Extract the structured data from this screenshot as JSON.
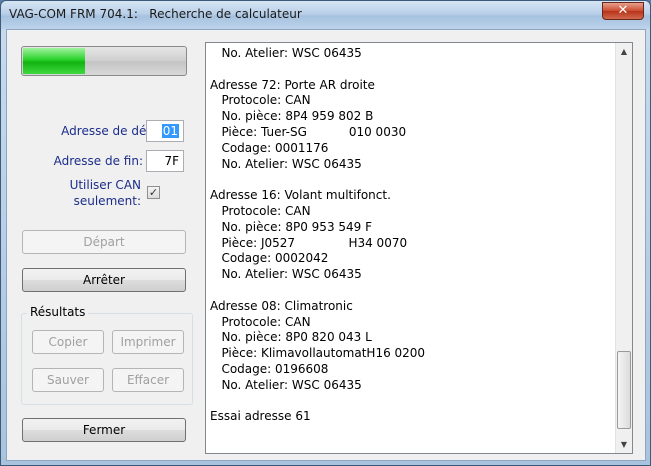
{
  "window": {
    "title": "VAG-COM FRM 704.1:   Recherche de calculateur",
    "close_glyph": "✕"
  },
  "progress": {
    "fraction": 0.38,
    "color": "#22c422"
  },
  "form": {
    "start_label": "Adresse de départ:",
    "start_value": "01",
    "end_label": "Adresse de fin:",
    "end_value": "7F",
    "can_label_line1": "Utiliser CAN",
    "can_label_line2": "seulement:",
    "can_checked": true,
    "check_glyph": "✓"
  },
  "buttons": {
    "start": "Départ",
    "stop": "Arrêter",
    "close": "Fermer"
  },
  "results_group": {
    "label": "Résultats",
    "copy": "Copier",
    "print": "Imprimer",
    "save": "Sauver",
    "clear": "Effacer"
  },
  "results_lines": [
    "   No. Atelier: WSC 06435",
    "",
    "Adresse 72: Porte AR droite",
    "   Protocole: CAN",
    "   No. pièce: 8P4 959 802 B",
    "   Pièce: Tuer-SG           010 0030",
    "   Codage: 0001176",
    "   No. Atelier: WSC 06435",
    "",
    "Adresse 16: Volant multifonct.",
    "   Protocole: CAN",
    "   No. pièce: 8P0 953 549 F",
    "   Pièce: J0527              H34 0070",
    "   Codage: 0002042",
    "   No. Atelier: WSC 06435",
    "",
    "Adresse 08: Climatronic",
    "   Protocole: CAN",
    "   No. pièce: 8P0 820 043 L",
    "   Pièce: KlimavollautomatH16 0200",
    "   Codage: 0196608",
    "   No. Atelier: WSC 06435",
    "",
    "Essai adresse 61"
  ],
  "scrollbar": {
    "up_glyph": "▲",
    "down_glyph": "▼"
  }
}
